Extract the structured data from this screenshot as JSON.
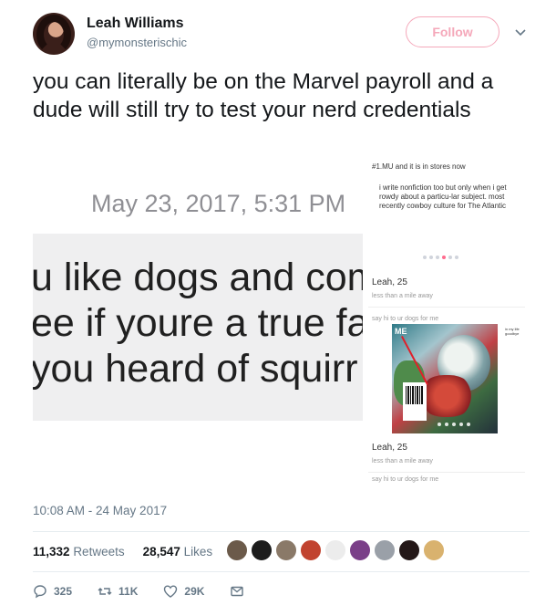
{
  "header": {
    "display_name": "Leah Williams",
    "handle": "@mymonsterischic",
    "follow_label": "Follow"
  },
  "tweet": {
    "text": "you can literally be on the Marvel payroll and a dude will still try to test your nerd credentials"
  },
  "media": {
    "left": {
      "date": "May 23, 2017, 5:31 PM",
      "lines": [
        "u like dogs and com",
        "ee if youre a true fa",
        "you heard of squirr"
      ]
    },
    "right": {
      "top_text": "#1.MU and it is in stores now",
      "bio": "i write nonfiction too but only when i get rowdy about a particu-lar subject. most recently cowboy culture for The Atlantic",
      "profile1_name": "Leah, 25",
      "profile1_distance": "less than a mile away",
      "say_hi_1": "say hi to ur dogs for me",
      "comic_label": "ME",
      "side_note": "in my life goodbye",
      "profile2_name": "Leah, 25",
      "profile2_distance": "less than a mile away",
      "say_hi_2": "say hi to ur dogs for me"
    }
  },
  "timestamp": "10:08 AM - 24 May 2017",
  "stats": {
    "retweets_count": "11,332",
    "retweets_label": "Retweets",
    "likes_count": "28,547",
    "likes_label": "Likes"
  },
  "likers": [
    {
      "color": "#6b5a4a"
    },
    {
      "color": "#1d1d1d"
    },
    {
      "color": "#8a7968"
    },
    {
      "color": "#c1432f"
    },
    {
      "color": "#ececec"
    },
    {
      "color": "#7a3f88"
    },
    {
      "color": "#9aa0a8"
    },
    {
      "color": "#241818"
    },
    {
      "color": "#d9b26e"
    }
  ],
  "actions": {
    "replies": "325",
    "retweets": "11K",
    "likes": "29K"
  },
  "colors": {
    "follow_accent": "#f5a8ba",
    "secondary_text": "#657786",
    "primary_text": "#14171a"
  }
}
